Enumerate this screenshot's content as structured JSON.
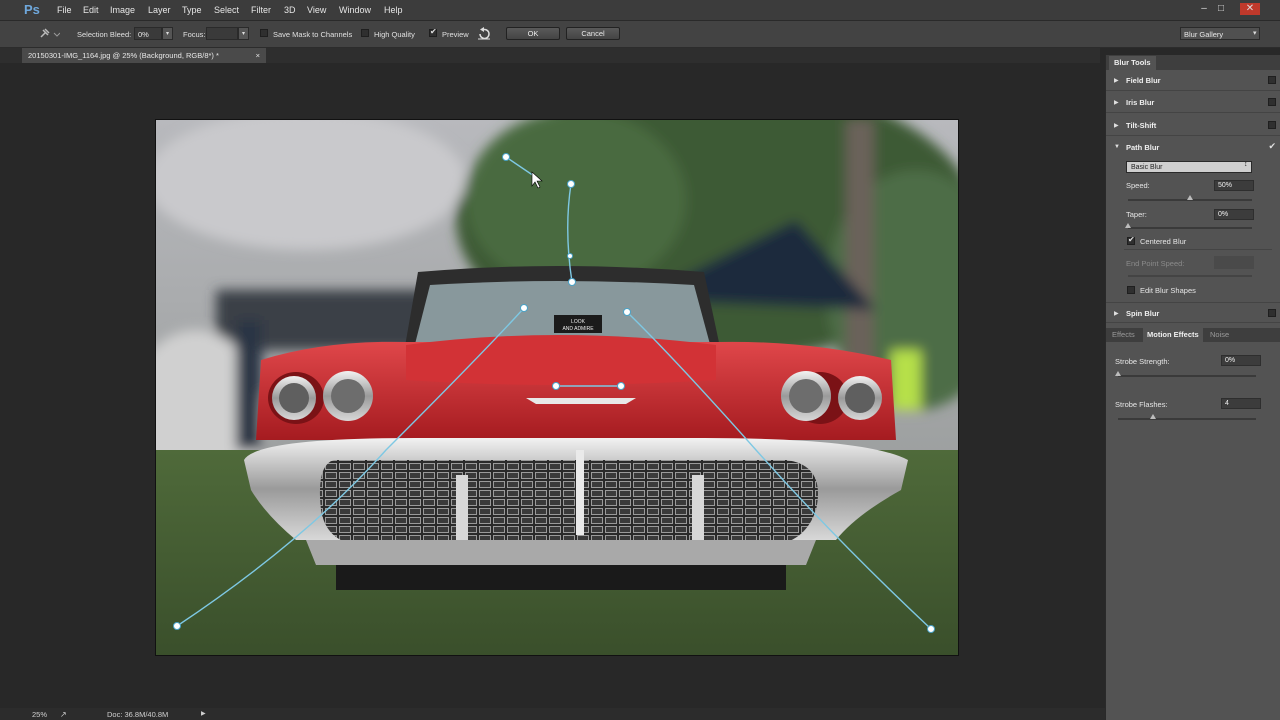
{
  "app": {
    "logo": "Ps"
  },
  "menu": [
    "File",
    "Edit",
    "Image",
    "Layer",
    "Type",
    "Select",
    "Filter",
    "3D",
    "View",
    "Window",
    "Help"
  ],
  "workspace": {
    "label": "Blur Gallery"
  },
  "options": {
    "selection_bleed_label": "Selection Bleed:",
    "selection_bleed_value": "0%",
    "focus_label": "Focus:",
    "focus_value": "",
    "save_mask_label": "Save Mask to Channels",
    "high_quality_label": "High Quality",
    "preview_label": "Preview",
    "ok_label": "OK",
    "cancel_label": "Cancel",
    "save_mask_checked": false,
    "high_quality_checked": false,
    "preview_checked": true
  },
  "document": {
    "tab_title": "20150301-IMG_1164.jpg @ 25% (Background, RGB/8*) *",
    "close": "×"
  },
  "photo": {
    "plate_line1": "LOOK",
    "plate_line2": "AND ADMIRE"
  },
  "panel": {
    "title": "Blur Tools",
    "sections": [
      {
        "label": "Field Blur",
        "expanded": false,
        "checked": false
      },
      {
        "label": "Iris Blur",
        "expanded": false,
        "checked": false
      },
      {
        "label": "Tilt-Shift",
        "expanded": false,
        "checked": false
      },
      {
        "label": "Path Blur",
        "expanded": true,
        "checked": true
      },
      {
        "label": "Spin Blur",
        "expanded": false,
        "checked": false
      }
    ],
    "path_blur": {
      "mode": "Basic Blur",
      "speed_label": "Speed:",
      "speed_value": "50%",
      "speed_level": 0.5,
      "taper_label": "Taper:",
      "taper_value": "0%",
      "taper_level": 0,
      "centered_blur_label": "Centered Blur",
      "centered_blur_checked": true,
      "end_point_speed_label": "End Point Speed:",
      "edit_blur_shapes_label": "Edit Blur Shapes",
      "edit_blur_shapes_checked": false
    },
    "effect_tabs": [
      "Effects",
      "Motion Effects",
      "Noise"
    ],
    "active_effect_tab": 1,
    "motion": {
      "strobe_strength_label": "Strobe Strength:",
      "strobe_strength_value": "0%",
      "strobe_strength_level": 0,
      "strobe_flashes_label": "Strobe Flashes:",
      "strobe_flashes_value": "4",
      "strobe_flashes_level": 0.25
    }
  },
  "status": {
    "zoom": "25%",
    "doc": "Doc: 36.8M/40.8M"
  },
  "colors": {
    "accent": "#6fa8dc",
    "path_line": "#7ec8e3",
    "car_red": "#c8272b"
  }
}
